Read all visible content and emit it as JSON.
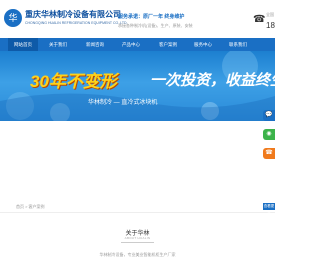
{
  "header": {
    "logo_text": "华",
    "company_name": "重庆华林制冷设备有限公司",
    "company_en": "CHONGQING HUALIN REFRIGERATION EQUIPMENT CO.,LTD.",
    "slogan_main": "服务承诺：原厂一年 终身维护",
    "slogan_sub": "承接各种制冷机(设备)、生产、原装、安装",
    "phone_label": "全国",
    "phone": "18"
  },
  "nav": {
    "items": [
      {
        "label": "网站首页"
      },
      {
        "label": "关于我们"
      },
      {
        "label": "新闻咨询"
      },
      {
        "label": "产品中心"
      },
      {
        "label": "客户案例"
      },
      {
        "label": "服务中心"
      },
      {
        "label": "联系我们"
      }
    ]
  },
  "banner": {
    "headline_yellow": "30年不变形",
    "headline_white": "一次投资，收益终生",
    "subline": "华林制冷 — 直冷式冰块机"
  },
  "side_tools": [
    {
      "icon": "chat-icon",
      "glyph": "💬",
      "color": "#1a6fc4"
    },
    {
      "icon": "wechat-icon",
      "glyph": "◉",
      "color": "#3cb34a"
    },
    {
      "icon": "phone-icon",
      "glyph": "☎",
      "color": "#f07a1c"
    }
  ],
  "breadcrumb": {
    "text": "首页 > 客户案例"
  },
  "more_label": "查看更多",
  "about": {
    "title": "关于华林",
    "subtitle": "ABOUT HUALIN",
    "text": "华林制冷设备，专业美业智能机柜生产厂家"
  },
  "colors": {
    "brand": "#1a6fc4",
    "banner_yellow": "#ffd21a"
  }
}
